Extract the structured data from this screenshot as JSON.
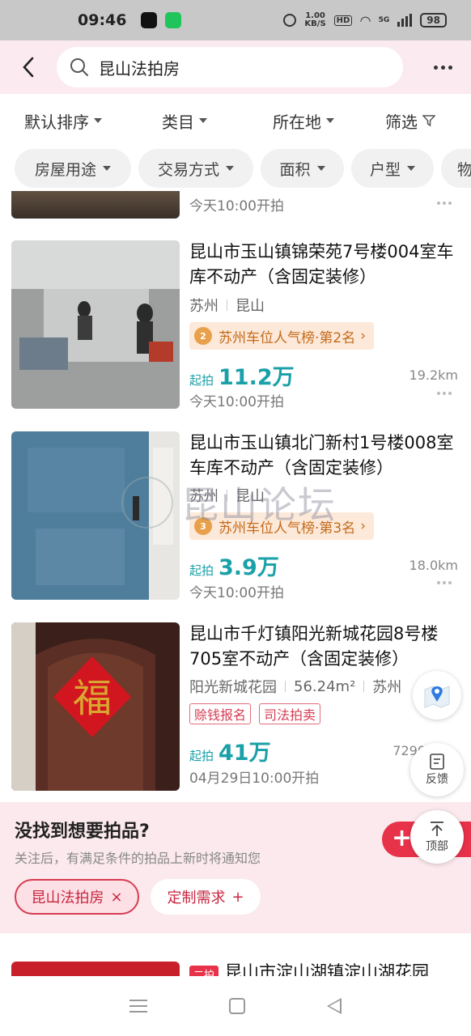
{
  "status_bar": {
    "time": "09:46",
    "network_speed": "1.00",
    "network_unit": "KB/S",
    "hd": "HD",
    "signal": "5G",
    "battery": "98"
  },
  "header": {
    "search_text": "昆山法拍房"
  },
  "sort_bar": [
    {
      "label": "默认排序"
    },
    {
      "label": "类目"
    },
    {
      "label": "所在地"
    },
    {
      "label": "筛选"
    }
  ],
  "filter_chips": [
    {
      "label": "房屋用途"
    },
    {
      "label": "交易方式"
    },
    {
      "label": "面积"
    },
    {
      "label": "户型"
    },
    {
      "label": "物"
    }
  ],
  "listings": [
    {
      "time": "今天10:00开拍"
    },
    {
      "title": "昆山市玉山镇锦荣苑7号楼004室车库不动产（含固定装修）",
      "city": "苏州",
      "district": "昆山",
      "rank": "苏州车位人气榜·第2名",
      "price_label": "起拍",
      "price": "11.2万",
      "distance": "19.2km",
      "time": "今天10:00开拍"
    },
    {
      "title": "昆山市玉山镇北门新村1号楼008室车库不动产（含固定装修）",
      "city": "苏州",
      "district": "昆山",
      "rank": "苏州车位人气榜·第3名",
      "price_label": "起拍",
      "price": "3.9万",
      "distance": "18.0km",
      "time": "今天10:00开拍"
    },
    {
      "title": "昆山市千灯镇阳光新城花园8号楼705室不动产（含固定装修）",
      "community": "阳光新城花园",
      "area": "56.24m²",
      "city": "苏州",
      "tags": [
        "赊钱报名",
        "司法拍卖"
      ],
      "price_label": "起拍",
      "price": "41万",
      "distance": "7290",
      "time": "04月29日10:00开拍"
    },
    {
      "badge": "二拍",
      "title": "昆山市淀山湖镇淀山湖花园"
    }
  ],
  "recommend": {
    "title": "没找到想要拍品?",
    "subtitle": "关注后，有满足条件的拍品上新时将通知您",
    "chip_selected": "昆山法拍房",
    "chip_custom": "定制需求",
    "follow_symbol": "+"
  },
  "floating": {
    "feedback": "反馈",
    "top": "顶部"
  },
  "watermark": {
    "text": "昆山论坛"
  }
}
